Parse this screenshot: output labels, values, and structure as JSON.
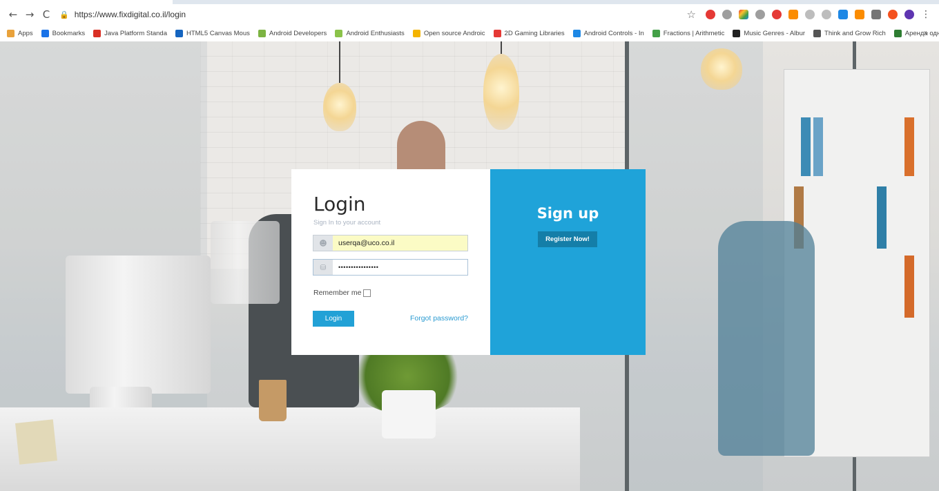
{
  "browser": {
    "url": "https://www.fixdigital.co.il/login",
    "nav_back": "←",
    "nav_forward": "→",
    "nav_reload": "C",
    "bookmarks": [
      {
        "label": "Apps",
        "color": "#e9a23b"
      },
      {
        "label": "Bookmarks",
        "color": "#1a73e8"
      },
      {
        "label": "Java Platform Standa",
        "color": "#d93025"
      },
      {
        "label": "HTML5 Canvas Mous",
        "color": "#1565c0"
      },
      {
        "label": "Android Developers",
        "color": "#7cb342"
      },
      {
        "label": "Android Enthusiasts",
        "color": "#8bc34a"
      },
      {
        "label": "Open source Androic",
        "color": "#f4b400"
      },
      {
        "label": "2D Gaming Libraries",
        "color": "#e53935"
      },
      {
        "label": "Android Controls - In",
        "color": "#1e88e5"
      },
      {
        "label": "Fractions | Arithmetic",
        "color": "#43a047"
      },
      {
        "label": "Music Genres - Albur",
        "color": "#212121"
      },
      {
        "label": "Think and Grow Rich",
        "color": "#555555"
      },
      {
        "label": "Аренда однокомнат",
        "color": "#2e7d32"
      }
    ],
    "bookmarks_more": "»"
  },
  "login": {
    "title": "Login",
    "subtitle": "Sign In to your account",
    "email_value": "userqa@uco.co.il",
    "password_value": "••••••••••••••••",
    "remember_label": "Remember me",
    "login_button": "Login",
    "forgot_link": "Forgot password?"
  },
  "signup": {
    "title": "Sign up",
    "register_button": "Register Now!"
  },
  "colors": {
    "accent": "#1fa3d9",
    "button": "#22a1d6",
    "register_button": "#147ea8",
    "email_autofill": "#fbfbc5"
  }
}
